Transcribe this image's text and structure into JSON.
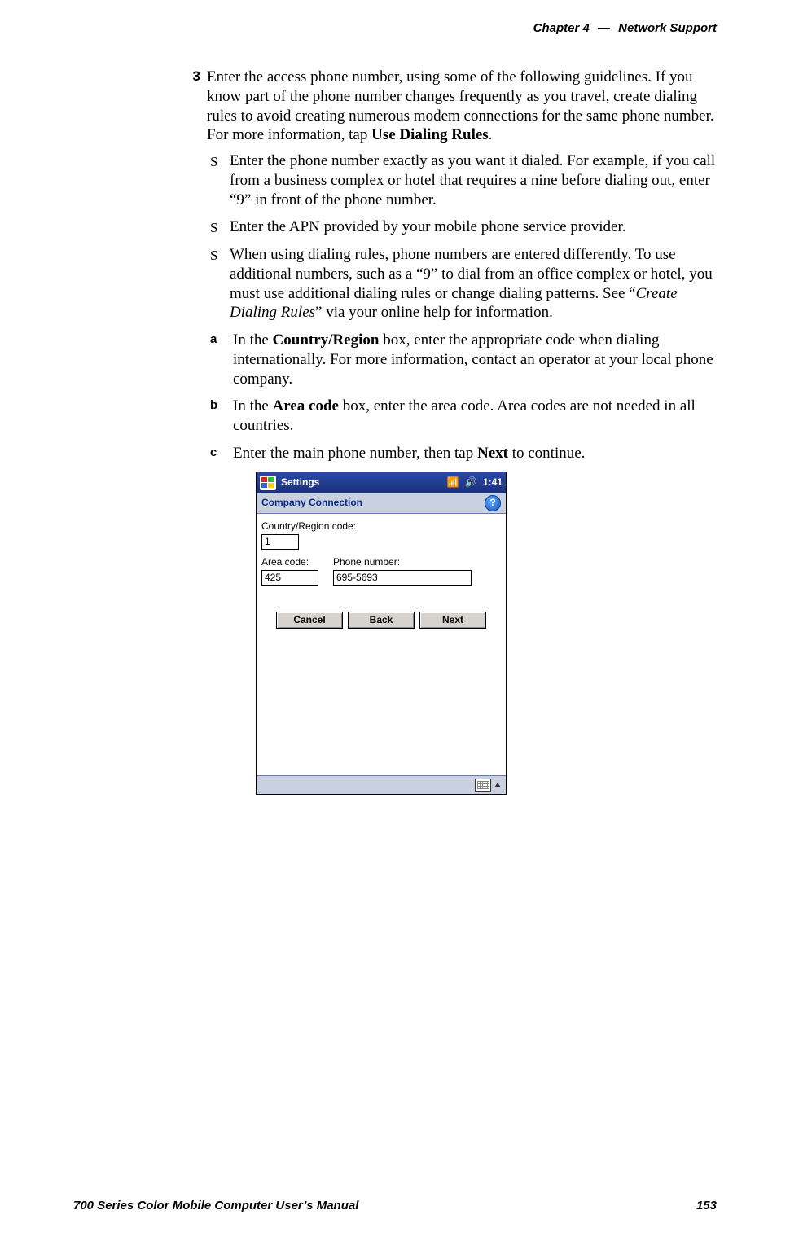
{
  "header": {
    "chapter_label": "Chapter  4",
    "separator": "—",
    "title": "Network Support"
  },
  "step": {
    "number": "3",
    "intro_pre": "Enter the access phone number, using some of the following guidelines. If you know part of the phone number changes frequently as you travel, create dialing rules to avoid creating numerous modem connections for the same phone number. For more information, tap ",
    "intro_bold": "Use Dialing Rules",
    "intro_post": ".",
    "bullets": [
      "Enter the phone number exactly as you want it dialed. For example, if you call from a business complex or hotel that requires a nine before dialing out, enter “9” in front of the phone number.",
      "Enter the APN provided by your mobile phone service provider."
    ],
    "bullet3": {
      "pre": "When using dialing rules, phone numbers are entered differently. To use additional numbers, such as a “9” to dial from an office complex or hotel, you must use additional dialing rules or change dialing patterns. See “",
      "italic": "Create Dialing Rules",
      "post": "” via your online help for information."
    },
    "subs": {
      "a": {
        "marker": "a",
        "pre": "In the ",
        "bold": "Country/Region",
        "post": " box, enter the appropriate code when dialing internationally. For more information, contact an operator at your local phone company."
      },
      "b": {
        "marker": "b",
        "pre": "In the ",
        "bold": "Area code",
        "post": " box, enter the area code. Area codes are not needed in all countries."
      },
      "c": {
        "marker": "c",
        "pre": "Enter the main phone number, then tap ",
        "bold": "Next",
        "post": " to continue."
      }
    }
  },
  "device": {
    "titlebar": {
      "title": "Settings",
      "time": "1:41"
    },
    "subbar": {
      "title": "Company Connection",
      "help": "?"
    },
    "labels": {
      "country": "Country/Region code:",
      "area": "Area code:",
      "phone": "Phone number:"
    },
    "values": {
      "country": "1",
      "area": "425",
      "phone": "695-5693"
    },
    "buttons": {
      "cancel": "Cancel",
      "back": "Back",
      "next": "Next"
    }
  },
  "footer": {
    "left": "700 Series Color Mobile Computer User’s Manual",
    "right": "153"
  }
}
